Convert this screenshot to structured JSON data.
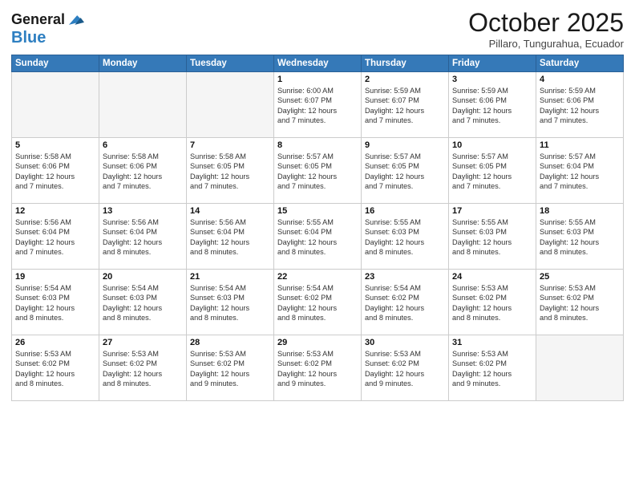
{
  "header": {
    "logo_line1": "General",
    "logo_line2": "Blue",
    "month_title": "October 2025",
    "location": "Pillaro, Tungurahua, Ecuador"
  },
  "days_of_week": [
    "Sunday",
    "Monday",
    "Tuesday",
    "Wednesday",
    "Thursday",
    "Friday",
    "Saturday"
  ],
  "weeks": [
    [
      {
        "day": "",
        "info": ""
      },
      {
        "day": "",
        "info": ""
      },
      {
        "day": "",
        "info": ""
      },
      {
        "day": "1",
        "info": "Sunrise: 6:00 AM\nSunset: 6:07 PM\nDaylight: 12 hours\nand 7 minutes."
      },
      {
        "day": "2",
        "info": "Sunrise: 5:59 AM\nSunset: 6:07 PM\nDaylight: 12 hours\nand 7 minutes."
      },
      {
        "day": "3",
        "info": "Sunrise: 5:59 AM\nSunset: 6:06 PM\nDaylight: 12 hours\nand 7 minutes."
      },
      {
        "day": "4",
        "info": "Sunrise: 5:59 AM\nSunset: 6:06 PM\nDaylight: 12 hours\nand 7 minutes."
      }
    ],
    [
      {
        "day": "5",
        "info": "Sunrise: 5:58 AM\nSunset: 6:06 PM\nDaylight: 12 hours\nand 7 minutes."
      },
      {
        "day": "6",
        "info": "Sunrise: 5:58 AM\nSunset: 6:06 PM\nDaylight: 12 hours\nand 7 minutes."
      },
      {
        "day": "7",
        "info": "Sunrise: 5:58 AM\nSunset: 6:05 PM\nDaylight: 12 hours\nand 7 minutes."
      },
      {
        "day": "8",
        "info": "Sunrise: 5:57 AM\nSunset: 6:05 PM\nDaylight: 12 hours\nand 7 minutes."
      },
      {
        "day": "9",
        "info": "Sunrise: 5:57 AM\nSunset: 6:05 PM\nDaylight: 12 hours\nand 7 minutes."
      },
      {
        "day": "10",
        "info": "Sunrise: 5:57 AM\nSunset: 6:05 PM\nDaylight: 12 hours\nand 7 minutes."
      },
      {
        "day": "11",
        "info": "Sunrise: 5:57 AM\nSunset: 6:04 PM\nDaylight: 12 hours\nand 7 minutes."
      }
    ],
    [
      {
        "day": "12",
        "info": "Sunrise: 5:56 AM\nSunset: 6:04 PM\nDaylight: 12 hours\nand 7 minutes."
      },
      {
        "day": "13",
        "info": "Sunrise: 5:56 AM\nSunset: 6:04 PM\nDaylight: 12 hours\nand 8 minutes."
      },
      {
        "day": "14",
        "info": "Sunrise: 5:56 AM\nSunset: 6:04 PM\nDaylight: 12 hours\nand 8 minutes."
      },
      {
        "day": "15",
        "info": "Sunrise: 5:55 AM\nSunset: 6:04 PM\nDaylight: 12 hours\nand 8 minutes."
      },
      {
        "day": "16",
        "info": "Sunrise: 5:55 AM\nSunset: 6:03 PM\nDaylight: 12 hours\nand 8 minutes."
      },
      {
        "day": "17",
        "info": "Sunrise: 5:55 AM\nSunset: 6:03 PM\nDaylight: 12 hours\nand 8 minutes."
      },
      {
        "day": "18",
        "info": "Sunrise: 5:55 AM\nSunset: 6:03 PM\nDaylight: 12 hours\nand 8 minutes."
      }
    ],
    [
      {
        "day": "19",
        "info": "Sunrise: 5:54 AM\nSunset: 6:03 PM\nDaylight: 12 hours\nand 8 minutes."
      },
      {
        "day": "20",
        "info": "Sunrise: 5:54 AM\nSunset: 6:03 PM\nDaylight: 12 hours\nand 8 minutes."
      },
      {
        "day": "21",
        "info": "Sunrise: 5:54 AM\nSunset: 6:03 PM\nDaylight: 12 hours\nand 8 minutes."
      },
      {
        "day": "22",
        "info": "Sunrise: 5:54 AM\nSunset: 6:02 PM\nDaylight: 12 hours\nand 8 minutes."
      },
      {
        "day": "23",
        "info": "Sunrise: 5:54 AM\nSunset: 6:02 PM\nDaylight: 12 hours\nand 8 minutes."
      },
      {
        "day": "24",
        "info": "Sunrise: 5:53 AM\nSunset: 6:02 PM\nDaylight: 12 hours\nand 8 minutes."
      },
      {
        "day": "25",
        "info": "Sunrise: 5:53 AM\nSunset: 6:02 PM\nDaylight: 12 hours\nand 8 minutes."
      }
    ],
    [
      {
        "day": "26",
        "info": "Sunrise: 5:53 AM\nSunset: 6:02 PM\nDaylight: 12 hours\nand 8 minutes."
      },
      {
        "day": "27",
        "info": "Sunrise: 5:53 AM\nSunset: 6:02 PM\nDaylight: 12 hours\nand 8 minutes."
      },
      {
        "day": "28",
        "info": "Sunrise: 5:53 AM\nSunset: 6:02 PM\nDaylight: 12 hours\nand 9 minutes."
      },
      {
        "day": "29",
        "info": "Sunrise: 5:53 AM\nSunset: 6:02 PM\nDaylight: 12 hours\nand 9 minutes."
      },
      {
        "day": "30",
        "info": "Sunrise: 5:53 AM\nSunset: 6:02 PM\nDaylight: 12 hours\nand 9 minutes."
      },
      {
        "day": "31",
        "info": "Sunrise: 5:53 AM\nSunset: 6:02 PM\nDaylight: 12 hours\nand 9 minutes."
      },
      {
        "day": "",
        "info": ""
      }
    ]
  ]
}
